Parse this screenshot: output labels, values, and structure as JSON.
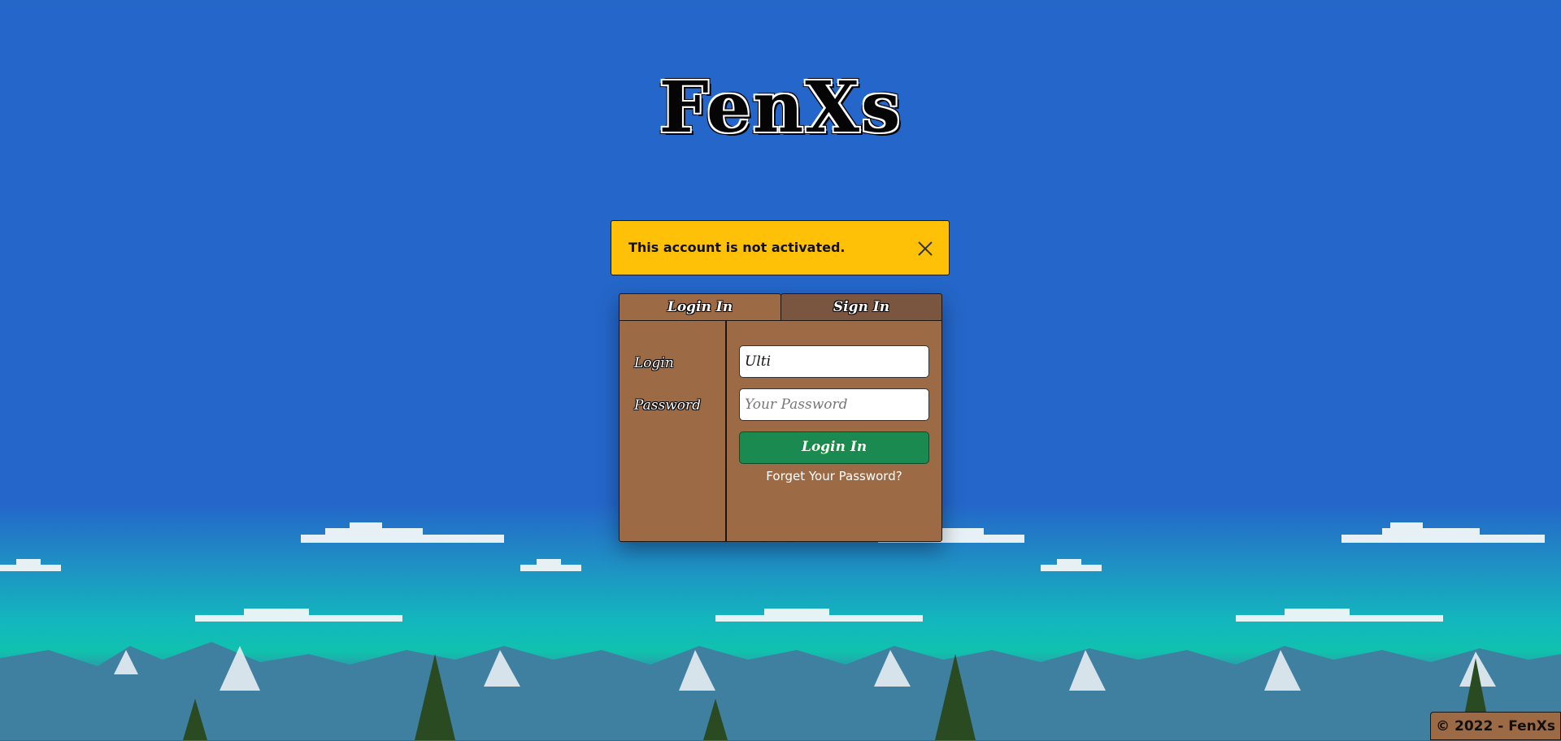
{
  "brand": {
    "logo_text": "FenXs"
  },
  "alert": {
    "message": "This account is not activated.",
    "close_icon": "close-icon",
    "color": "#ffc107"
  },
  "tabs": [
    {
      "label": "Login In",
      "active": true
    },
    {
      "label": "Sign In",
      "active": false
    }
  ],
  "form": {
    "login_label": "Login",
    "password_label": "Password",
    "login_value": "Ulti",
    "password_placeholder": "Your Password",
    "submit_label": "Login In",
    "forgot_label": "Forget Your Password?"
  },
  "footer": {
    "copyright": "© 2022 - FenXs"
  },
  "colors": {
    "sky": "#2466c9",
    "panel": "#9c6a44",
    "tab_inactive": "#7a5540",
    "button": "#1b8a50"
  }
}
